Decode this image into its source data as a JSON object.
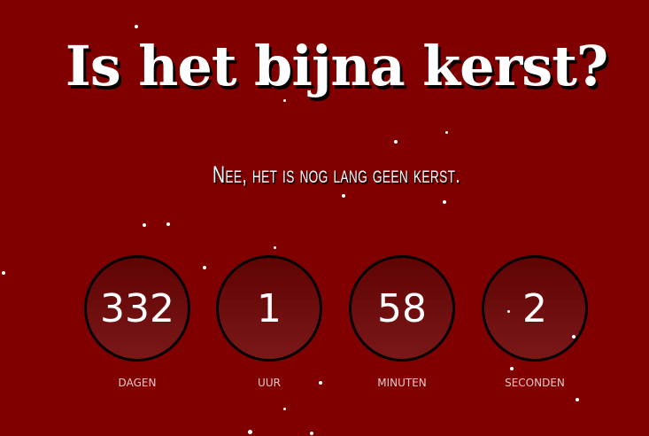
{
  "title": "Is het bijna kerst?",
  "subtitle": "Nee, het is nog lang geen kerst.",
  "countdown": [
    {
      "value": "332",
      "label": "DAGEN"
    },
    {
      "value": "1",
      "label": "UUR"
    },
    {
      "value": "58",
      "label": "MINUTEN"
    },
    {
      "value": "2",
      "label": "SECONDEN"
    }
  ],
  "colors": {
    "background": "#800000",
    "circle_top": "#600303",
    "circle_bottom": "#7a1818"
  }
}
